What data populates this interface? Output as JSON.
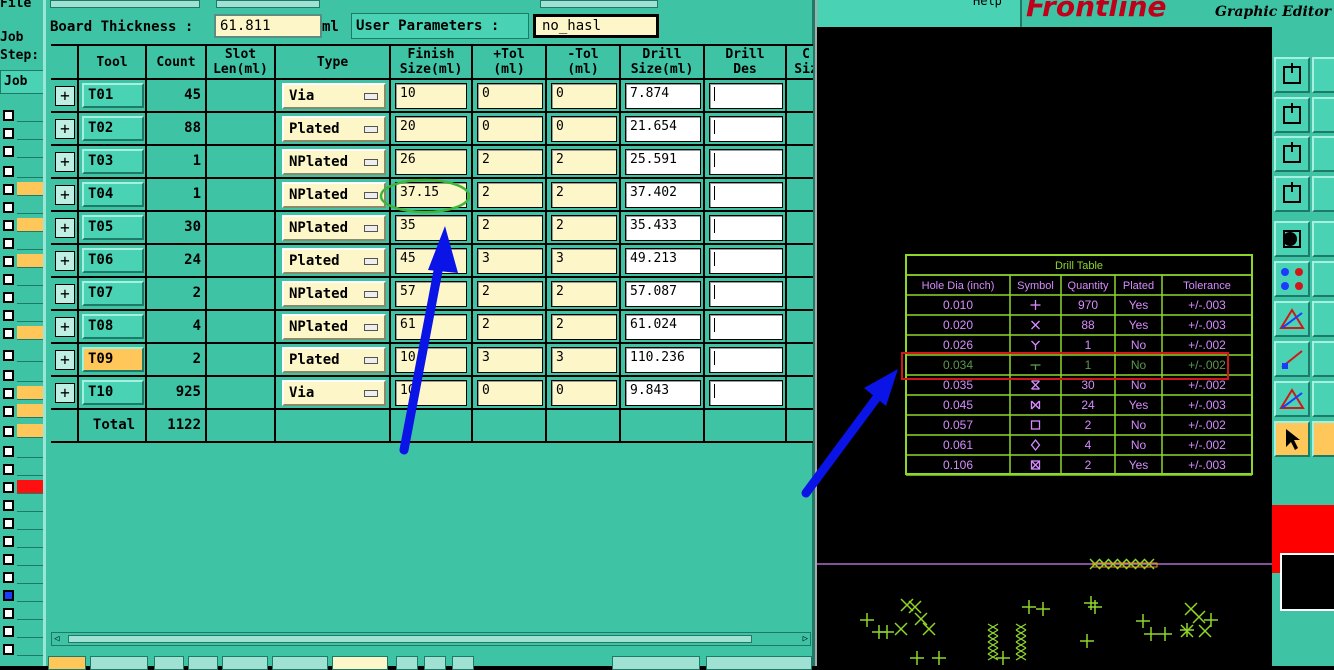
{
  "left_strip": {
    "labels": [
      "Job",
      "Step:",
      "Job"
    ]
  },
  "dialog": {
    "board_thickness_label": "Board Thickness :",
    "board_thickness_value": "61.811",
    "board_thickness_unit": "ml",
    "user_params_label": "User Parameters :",
    "user_params_value": "no_hasl",
    "columns": [
      "Tool",
      "Count",
      "Slot\nLen(ml)",
      "Type",
      "Finish\nSize(ml)",
      "+Tol\n(ml)",
      "-Tol\n(ml)",
      "Drill\nSize(ml)",
      "Drill\nDes",
      "C\nSiz"
    ],
    "rows": [
      {
        "tool": "T01",
        "count": "45",
        "type": "Via",
        "finish": "10",
        "ptol": "0",
        "mtol": "0",
        "drill": "7.874",
        "des": ""
      },
      {
        "tool": "T02",
        "count": "88",
        "type": "Plated",
        "finish": "20",
        "ptol": "0",
        "mtol": "0",
        "drill": "21.654",
        "des": ""
      },
      {
        "tool": "T03",
        "count": "1",
        "type": "NPlated",
        "finish": "26",
        "ptol": "2",
        "mtol": "2",
        "drill": "25.591",
        "des": ""
      },
      {
        "tool": "T04",
        "count": "1",
        "type": "NPlated",
        "finish": "37.15",
        "ptol": "2",
        "mtol": "2",
        "drill": "37.402",
        "des": ""
      },
      {
        "tool": "T05",
        "count": "30",
        "type": "NPlated",
        "finish": "35",
        "ptol": "2",
        "mtol": "2",
        "drill": "35.433",
        "des": ""
      },
      {
        "tool": "T06",
        "count": "24",
        "type": "Plated",
        "finish": "45",
        "ptol": "3",
        "mtol": "3",
        "drill": "49.213",
        "des": ""
      },
      {
        "tool": "T07",
        "count": "2",
        "type": "NPlated",
        "finish": "57",
        "ptol": "2",
        "mtol": "2",
        "drill": "57.087",
        "des": ""
      },
      {
        "tool": "T08",
        "count": "4",
        "type": "NPlated",
        "finish": "61",
        "ptol": "2",
        "mtol": "2",
        "drill": "61.024",
        "des": ""
      },
      {
        "tool": "T09",
        "count": "2",
        "type": "Plated",
        "finish": "10",
        "ptol": "3",
        "mtol": "3",
        "drill": "110.236",
        "des": ""
      },
      {
        "tool": "T10",
        "count": "925",
        "type": "Via",
        "finish": "10",
        "ptol": "0",
        "mtol": "0",
        "drill": "9.843",
        "des": ""
      }
    ],
    "total_label": "Total",
    "total_count": "1122"
  },
  "editor": {
    "brand": "Frontline",
    "title": "Graphic Editor",
    "help_label": "Help",
    "drill_table": {
      "title": "Drill Table",
      "headers": [
        "Hole Dia (inch)",
        "Symbol",
        "Quantity",
        "Plated",
        "Tolerance"
      ],
      "rows": [
        {
          "dia": "0.010",
          "sym": "plus",
          "qty": "970",
          "plated": "Yes",
          "tol": "+/-.003"
        },
        {
          "dia": "0.020",
          "sym": "x",
          "qty": "88",
          "plated": "Yes",
          "tol": "+/-.003"
        },
        {
          "dia": "0.026",
          "sym": "y",
          "qty": "1",
          "plated": "No",
          "tol": "+/-.002"
        },
        {
          "dia": "0.034",
          "sym": "t",
          "qty": "1",
          "plated": "No",
          "tol": "+/-.002"
        },
        {
          "dia": "0.035",
          "sym": "hourglass",
          "qty": "30",
          "plated": "No",
          "tol": "+/-.002"
        },
        {
          "dia": "0.045",
          "sym": "bowtie",
          "qty": "24",
          "plated": "Yes",
          "tol": "+/-.003"
        },
        {
          "dia": "0.057",
          "sym": "square-dot",
          "qty": "2",
          "plated": "No",
          "tol": "+/-.002"
        },
        {
          "dia": "0.061",
          "sym": "diamond",
          "qty": "4",
          "plated": "No",
          "tol": "+/-.002"
        },
        {
          "dia": "0.106",
          "sym": "square-x",
          "qty": "2",
          "plated": "Yes",
          "tol": "+/-.003"
        }
      ]
    }
  },
  "colors": {
    "panel": "#3ec3a5",
    "field": "#fdf6c8",
    "selected": "#ffc65a",
    "annotation_arrow": "#0a14e6",
    "annotation_circle": "#3fb53a",
    "annotation_box": "#d01818",
    "drill_table": "#8fd62b",
    "drill_text": "#d68cff"
  },
  "icons": [
    "plus-expand-icon",
    "dropdown-arrow-icon",
    "pointer-arrow-icon",
    "zoom-fit-icon",
    "undo-icon",
    "copy-icon",
    "move-icon",
    "measure-icon",
    "circle-icon",
    "line-icon",
    "triangle-icon"
  ]
}
